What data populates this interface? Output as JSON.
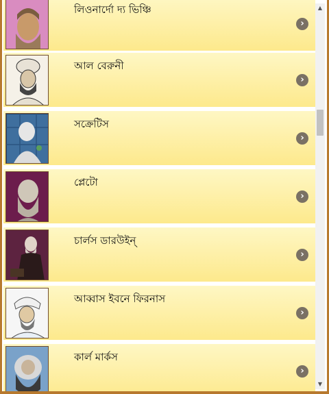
{
  "list": {
    "items": [
      {
        "name": "লিওনার্দো দ্য ভিঞ্চি",
        "portrait": "leonardo-portrait"
      },
      {
        "name": "আল বেরুনী",
        "portrait": "al-biruni-portrait"
      },
      {
        "name": "সক্রেটিস",
        "portrait": "socrates-portrait"
      },
      {
        "name": "প্লেটো",
        "portrait": "plato-portrait"
      },
      {
        "name": "চার্লস ডারউইন্",
        "portrait": "darwin-portrait"
      },
      {
        "name": "আব্বাস ইবনে ফিরনাস",
        "portrait": "ibn-firnas-portrait"
      },
      {
        "name": "কার্ল মার্কস",
        "portrait": "marx-portrait"
      }
    ],
    "chevron_glyph": "›"
  },
  "colors": {
    "row_top": "#fef7c4",
    "row_bottom": "#fde98c",
    "frame": "#b7792e",
    "chevron_bg": "#7a7164"
  }
}
